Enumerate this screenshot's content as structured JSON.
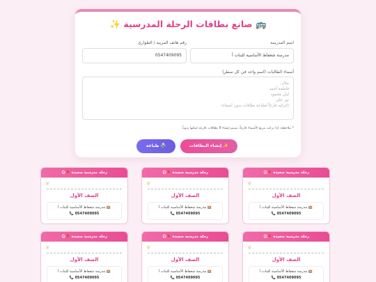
{
  "app": {
    "title": "🚌 صانع بطاقات الرحلة المدرسية ✨"
  },
  "form": {
    "school_label": "اسم المدرسة",
    "school_value": "مدرسة شعفاط الأساسية للبنات أ",
    "phone_label": "رقم هاتف المربية / الطوارئ",
    "phone_value": "0547409095",
    "students_label": "أسماء الطالبات (اسم واحد في كل سطر)",
    "students_placeholder": "مثال:\nفاطمة أحمد\nليان محمود\nنور علي\n(اتركيه فارغاً لطباعة بطاقات بدون أسماء)",
    "note": "* ملاحظة: إذا تركت مربع الأسماء فارغاً، سيتم إنشاء 9 بطاقات فارغة لملئها يدوياً.",
    "generate_label": "✨ إنشاء البطاقات",
    "print_label": "🖨️ طباعة"
  },
  "cards": [
    {
      "header": "رحلة مدرسية سعيدة 🎈🌸",
      "grade": "الصف الأول",
      "school": "🏫 مدرسة شعفاط الأساسية للبنات أ",
      "phone": "📞 0547409095"
    },
    {
      "header": "رحلة مدرسية سعيدة 🎈🌸",
      "grade": "الصف الأول",
      "school": "🏫 مدرسة شعفاط الأساسية للبنات أ",
      "phone": "📞 0547409095"
    },
    {
      "header": "رحلة مدرسية سعيدة 🎈🌸",
      "grade": "الصف الأول",
      "school": "🏫 مدرسة شعفاط الأساسية للبنات أ",
      "phone": "📞 0547409095"
    },
    {
      "header": "رحلة مدرسية سعيدة 🎈🌸",
      "grade": "الصف الأول",
      "school": "🏫 مدرسة شعفاط الأساسية للبنات أ",
      "phone": "📞 0547409095"
    },
    {
      "header": "رحلة مدرسية سعيدة 🎈🌸",
      "grade": "الصف الأول",
      "school": "🏫 مدرسة شعفاط الأساسية للبنات أ",
      "phone": "📞 0547409095"
    },
    {
      "header": "رحلة مدرسية سعيدة 🎈🌸",
      "grade": "الصف الأول",
      "school": "🏫 مدرسة شعفاط الأساسية للبنات أ",
      "phone": "📞 0547409095"
    }
  ],
  "colors": {
    "accent": "#e0418b",
    "print_button": "#6d5be0",
    "background": "#fbeef5"
  }
}
